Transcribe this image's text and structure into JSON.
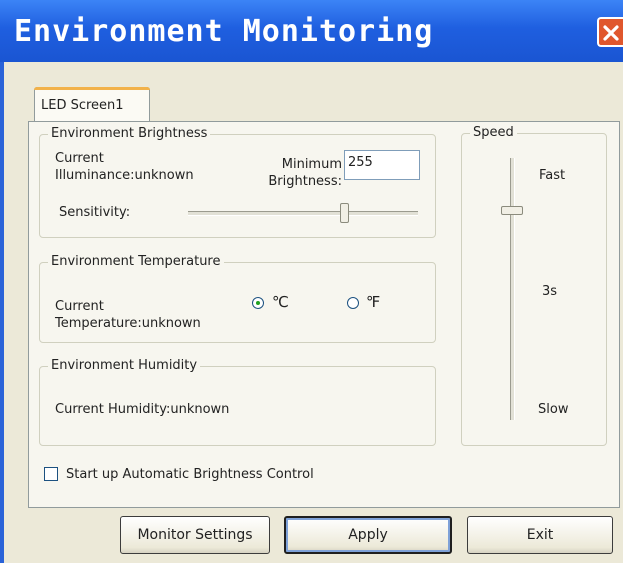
{
  "window": {
    "title": "Environment Monitoring",
    "close_icon": "close-icon",
    "titlebar_color": "#1f5fe0",
    "close_color": "#e0572d"
  },
  "tabs": [
    {
      "label": "LED Screen1",
      "selected": true
    }
  ],
  "brightness": {
    "legend": "Environment Brightness",
    "current_label_line1": "Current",
    "current_label_line2": "Illuminance:unknown",
    "minimum_label_line1": "Minimum",
    "minimum_label_line2": "Brightness:",
    "minimum_value": "255",
    "sensitivity_label": "Sensitivity:",
    "sensitivity_level": 0.68
  },
  "temperature": {
    "legend": "Environment Temperature",
    "current_label_line1": "Current",
    "current_label_line2": "Temperature:unknown",
    "unit_celsius": "℃",
    "unit_fahrenheit": "℉",
    "selected_unit": "celsius"
  },
  "humidity": {
    "legend": "Environment Humidity",
    "current_label": "Current Humidity:unknown"
  },
  "speed": {
    "legend": "Speed",
    "fast_label": "Fast",
    "mid_label": "3s",
    "slow_label": "Slow",
    "level_from_top": 0.2
  },
  "auto_control": {
    "label": "Start up Automatic Brightness Control",
    "checked": false
  },
  "buttons": {
    "monitor_settings": "Monitor Settings",
    "apply": "Apply",
    "exit": "Exit"
  }
}
